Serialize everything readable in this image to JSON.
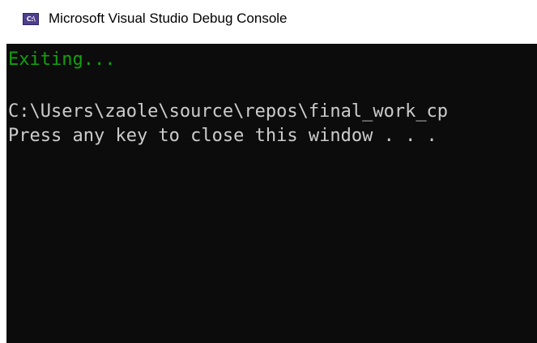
{
  "window": {
    "title": "Microsoft Visual Studio Debug Console",
    "icon": "console-app-icon",
    "icon_text": "C:\\"
  },
  "console": {
    "lines": [
      "Exiting...",
      "",
      "C:\\Users\\zaole\\source\\repos\\final_work_cp",
      "Press any key to close this window . . ."
    ],
    "colors": {
      "background": "#0c0c0c",
      "text": "#cccccc",
      "highlight": "#13a10e"
    }
  }
}
